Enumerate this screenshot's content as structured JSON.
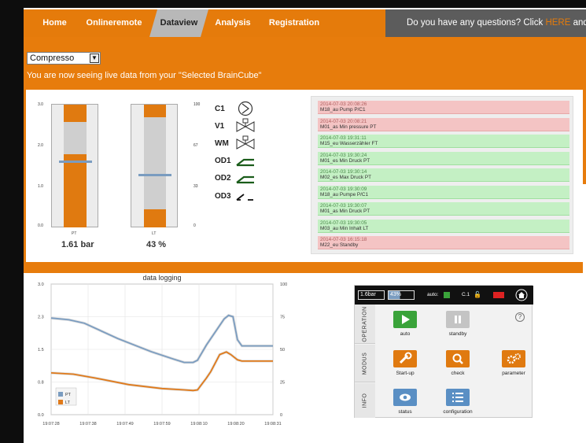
{
  "nav": {
    "items": [
      "Home",
      "Onlineremote",
      "Dataview",
      "Analysis",
      "Registration"
    ],
    "help_before": "Do you have any questions? Click ",
    "help_link": "HERE",
    "help_after": " and let us know"
  },
  "cube_select": {
    "value": "Compresso"
  },
  "notice": "You are now seeing live data from your \"Selected BrainCube\"",
  "gauges": {
    "left_axis": [
      "3.0",
      "2.0",
      "1.0",
      "0.0"
    ],
    "right_axis": [
      "100",
      "67",
      "33",
      "0"
    ],
    "pt": {
      "label": "PT",
      "value": "1.61 bar",
      "level": 0.54
    },
    "lt": {
      "label": "LT",
      "value": "43 %",
      "level": 0.43
    }
  },
  "devices": [
    "C1",
    "V1",
    "WM",
    "OD1",
    "OD2",
    "OD3"
  ],
  "alarms": [
    {
      "time": "2014-07-03 20:08:26",
      "msg": "M18_au Pump P/C1",
      "status": "alarm"
    },
    {
      "time": "2014-07-03 20:08:21",
      "msg": "M01_as Min pressure PT",
      "status": "alarm"
    },
    {
      "time": "2014-07-03 19:31:11",
      "msg": "M15_eu Wasserzähler FT",
      "status": "ok"
    },
    {
      "time": "2014-07-03 19:30:24",
      "msg": "M01_es Min Druck PT",
      "status": "ok"
    },
    {
      "time": "2014-07-03 19:30:14",
      "msg": "M02_es Max Druck PT",
      "status": "ok"
    },
    {
      "time": "2014-07-03 19:30:09",
      "msg": "M18_au Pumpe P/C1",
      "status": "ok"
    },
    {
      "time": "2014-07-03 19:30:07",
      "msg": "M01_as Min Druck PT",
      "status": "ok"
    },
    {
      "time": "2014-07-03 19:30:05",
      "msg": "M03_au Min Inhalt LT",
      "status": "ok"
    },
    {
      "time": "2014-07-03 16:15:18",
      "msg": "M22_eu Standby",
      "status": "alarm"
    }
  ],
  "chart_data": {
    "type": "line",
    "title": "data logging",
    "x": [
      "19:07:28",
      "19:07:38",
      "19:07:49",
      "19:07:59",
      "19:08:10",
      "19:08:20",
      "19:08:31"
    ],
    "y_left": {
      "ticks": [
        "0.0",
        "0.8",
        "1.5",
        "2.3",
        "3.0"
      ],
      "range": [
        0,
        3
      ]
    },
    "y_right": {
      "ticks": [
        "0",
        "25",
        "50",
        "75",
        "100"
      ],
      "range": [
        0,
        100
      ]
    },
    "series": [
      {
        "name": "PT",
        "axis": "left",
        "color": "#7a9cc0",
        "points": [
          [
            0,
            2.22
          ],
          [
            0.08,
            2.18
          ],
          [
            0.15,
            2.1
          ],
          [
            0.3,
            1.75
          ],
          [
            0.45,
            1.45
          ],
          [
            0.55,
            1.28
          ],
          [
            0.6,
            1.2
          ],
          [
            0.64,
            1.2
          ],
          [
            0.66,
            1.25
          ],
          [
            0.7,
            1.6
          ],
          [
            0.72,
            1.75
          ],
          [
            0.78,
            2.2
          ],
          [
            0.8,
            2.28
          ],
          [
            0.82,
            2.25
          ],
          [
            0.84,
            1.72
          ],
          [
            0.86,
            1.58
          ],
          [
            1.0,
            1.58
          ]
        ]
      },
      {
        "name": "LT",
        "axis": "right",
        "color": "#e07a1a",
        "points": [
          [
            0,
            32
          ],
          [
            0.1,
            31
          ],
          [
            0.2,
            28
          ],
          [
            0.35,
            23
          ],
          [
            0.5,
            20
          ],
          [
            0.6,
            19
          ],
          [
            0.64,
            18.5
          ],
          [
            0.66,
            19
          ],
          [
            0.7,
            28
          ],
          [
            0.72,
            33
          ],
          [
            0.76,
            46
          ],
          [
            0.79,
            48
          ],
          [
            0.81,
            46
          ],
          [
            0.84,
            42
          ],
          [
            0.86,
            41
          ],
          [
            1.0,
            41
          ]
        ]
      }
    ]
  },
  "control": {
    "pressure": "1.6bar",
    "level": "43%",
    "auto_label": "auto:",
    "c1_label": "C.1",
    "sections": [
      "OPERATION",
      "MODUS",
      "INFO"
    ],
    "buttons": {
      "auto": "auto",
      "standby": "standby",
      "startup": "Start-up",
      "check": "check",
      "parameter": "parameter",
      "status": "status",
      "configuration": "configuration"
    },
    "help": "?"
  }
}
